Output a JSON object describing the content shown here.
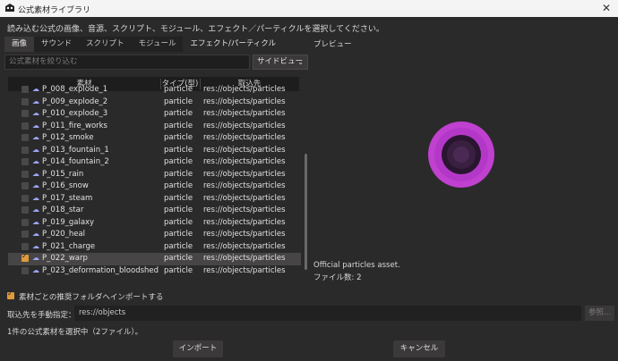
{
  "window": {
    "title": "公式素材ライブラリ",
    "close_glyph": "✕",
    "icon": "godot-icon"
  },
  "instruction": "読み込む公式の画像、音源、スクリプト、モジュール、エフェクト／パーティクルを選択してください。",
  "tabs": [
    {
      "label": "画像"
    },
    {
      "label": "サウンド"
    },
    {
      "label": "スクリプト"
    },
    {
      "label": "モジュール"
    },
    {
      "label": "エフェクト/パーティクル"
    }
  ],
  "selected_tab": "エフェクト/パーティクル",
  "filter": {
    "placeholder": "公式素材を絞り込む"
  },
  "view_mode": {
    "value": "サイドビュー",
    "chevron": "⌄"
  },
  "list": {
    "headers": {
      "name": "素材",
      "type": "タイプ(型)",
      "dest": "取込先"
    },
    "rows": [
      {
        "name": "P_008_explode_1",
        "type": "particle",
        "path": "res://objects/particles",
        "checked": false
      },
      {
        "name": "P_009_explode_2",
        "type": "particle",
        "path": "res://objects/particles",
        "checked": false
      },
      {
        "name": "P_010_explode_3",
        "type": "particle",
        "path": "res://objects/particles",
        "checked": false
      },
      {
        "name": "P_011_fire_works",
        "type": "particle",
        "path": "res://objects/particles",
        "checked": false
      },
      {
        "name": "P_012_smoke",
        "type": "particle",
        "path": "res://objects/particles",
        "checked": false
      },
      {
        "name": "P_013_fountain_1",
        "type": "particle",
        "path": "res://objects/particles",
        "checked": false
      },
      {
        "name": "P_014_fountain_2",
        "type": "particle",
        "path": "res://objects/particles",
        "checked": false
      },
      {
        "name": "P_015_rain",
        "type": "particle",
        "path": "res://objects/particles",
        "checked": false
      },
      {
        "name": "P_016_snow",
        "type": "particle",
        "path": "res://objects/particles",
        "checked": false
      },
      {
        "name": "P_017_steam",
        "type": "particle",
        "path": "res://objects/particles",
        "checked": false
      },
      {
        "name": "P_018_star",
        "type": "particle",
        "path": "res://objects/particles",
        "checked": false
      },
      {
        "name": "P_019_galaxy",
        "type": "particle",
        "path": "res://objects/particles",
        "checked": false
      },
      {
        "name": "P_020_heal",
        "type": "particle",
        "path": "res://objects/particles",
        "checked": false
      },
      {
        "name": "P_021_charge",
        "type": "particle",
        "path": "res://objects/particles",
        "checked": false
      },
      {
        "name": "P_022_warp",
        "type": "particle",
        "path": "res://objects/particles",
        "checked": true
      },
      {
        "name": "P_023_deformation_bloodshed",
        "type": "particle",
        "path": "res://objects/particles",
        "checked": false
      }
    ],
    "row_icon": "particle-icon",
    "row_icon_glyph": "☁"
  },
  "preview": {
    "label": "プレビュー",
    "description": "Official particles asset.",
    "file_count": "ファイル数: 2",
    "colors": {
      "outer": "#c040d0",
      "inner": "#2a1530"
    }
  },
  "recommend": {
    "label": "素材ごとの推奨フォルダへインポートする",
    "checked": true
  },
  "destination": {
    "label": "取込先を手動指定：",
    "value": "res://objects",
    "browse": "参照..."
  },
  "status": "1件の公式素材を選択中（2ファイル）。",
  "buttons": {
    "import": "インポート",
    "cancel": "キャンセル"
  },
  "colors": {
    "accent": "#e09a3c",
    "background": "#2b2a2a"
  }
}
